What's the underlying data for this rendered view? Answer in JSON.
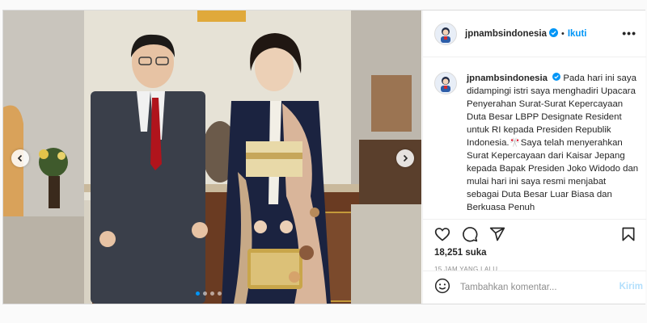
{
  "post": {
    "username": "jpnambsindonesia",
    "follow_label": "Ikuti",
    "more_label": "•••",
    "caption_username": "jpnambsindonesia",
    "caption_text": "Pada hari ini saya didampingi istri saya menghadiri Upacara Penyerahan Surat-Surat Kepercayaan Duta Besar LBPP Designate Resident untuk RI kepada Presiden Republik Indonesia.🎌Saya telah menyerahkan Surat Kepercayaan dari Kaisar Jepang kepada Bapak Presiden Joko Widodo dan mulai hari ini saya resmi menjabat sebagai Duta Besar Luar Biasa dan Berkuasa Penuh",
    "likes": "18,251 suka",
    "timestamp": "15 JAM YANG LALU",
    "comment_placeholder": "Tambahkan komentar...",
    "post_button": "Kirim"
  },
  "carousel": {
    "total_slides": 4,
    "active_slide": 1
  },
  "icons": {
    "like": "heart-icon",
    "comment": "comment-icon",
    "share": "share-icon",
    "save": "bookmark-icon",
    "emoji": "emoji-icon",
    "verified": "verified-badge-icon",
    "prev": "chevron-left-icon",
    "next": "chevron-right-icon"
  },
  "colors": {
    "accent": "#0095f6",
    "post_disabled": "#b2dffc",
    "text": "#262626",
    "muted": "#8e8e8e"
  }
}
